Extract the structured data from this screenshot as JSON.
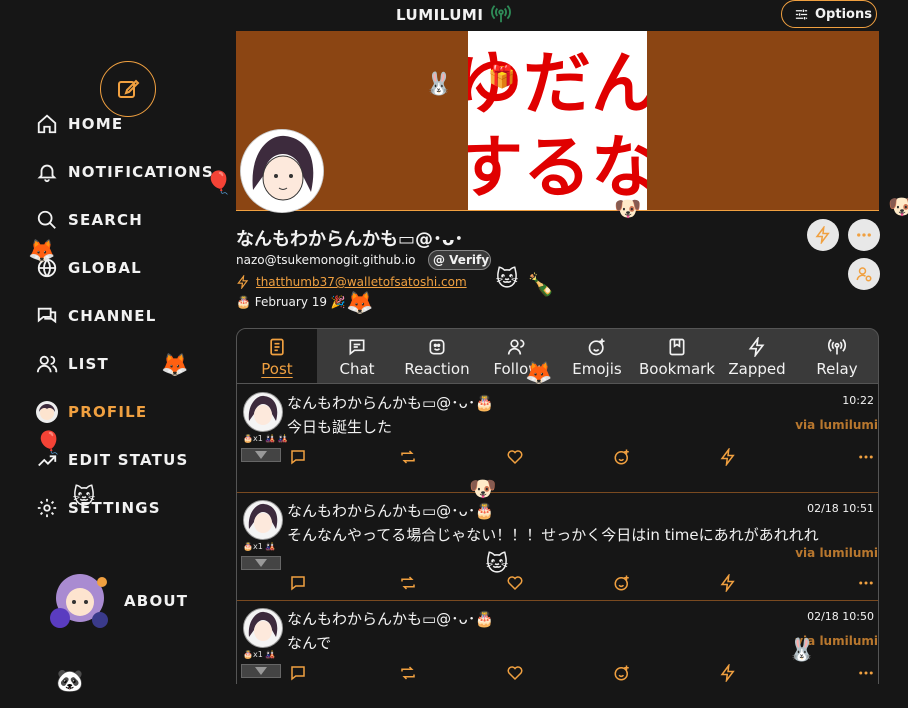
{
  "header": {
    "brand": "LUMILUMI",
    "options_label": "Options"
  },
  "sidebar": {
    "items": [
      {
        "label": "HOME",
        "icon": "home-icon"
      },
      {
        "label": "NOTIFICATIONS",
        "icon": "bell-icon"
      },
      {
        "label": "SEARCH",
        "icon": "search-icon"
      },
      {
        "label": "GLOBAL",
        "icon": "globe-icon"
      },
      {
        "label": "CHANNEL",
        "icon": "chat-icon"
      },
      {
        "label": "LIST",
        "icon": "users-icon"
      },
      {
        "label": "PROFILE",
        "icon": "avatar"
      },
      {
        "label": "EDIT STATUS",
        "icon": "status-icon"
      },
      {
        "label": "SETTINGS",
        "icon": "gear-icon"
      }
    ],
    "about_label": "ABOUT"
  },
  "profile": {
    "display_name": "なんもわからんかも▭@･ᴗ･",
    "nip05": "nazo@tsukemonogit.github.io",
    "verify_label": "@ Verify",
    "lud16": "thatthumb37@walletofsatoshi.com",
    "birthday": "🎂 February 19 🎉",
    "banner_text": "ゆだんするな"
  },
  "tabs": [
    {
      "label": "Post",
      "active": true
    },
    {
      "label": "Chat"
    },
    {
      "label": "Reaction"
    },
    {
      "label": "Follow"
    },
    {
      "label": "Emojis"
    },
    {
      "label": "Bookmark"
    },
    {
      "label": "Zapped"
    },
    {
      "label": "Relay"
    }
  ],
  "posts": [
    {
      "author": "なんもわからんかも▭@･ᴗ･🎂",
      "time": "10:22",
      "content": "今日も誕生した",
      "via": "via lumilumi",
      "mini": "🎂x1 🎎 🎎"
    },
    {
      "author": "なんもわからんかも▭@･ᴗ･🎂",
      "time": "02/18 10:51",
      "content": "そんなんやってる場合じゃない！！！せっかく今日はin timeにあれがあれれれ",
      "via": "via lumilumi",
      "mini": "🎂x1 🎎"
    },
    {
      "author": "なんもわからんかも▭@･ᴗ･🎂",
      "time": "02/18 10:50",
      "content": "なんで",
      "via": "via lumilumi",
      "mini": "🎂x1 🎎"
    }
  ],
  "colors": {
    "accent": "#f0a040",
    "background": "#161616",
    "banner": "#8b4513"
  }
}
